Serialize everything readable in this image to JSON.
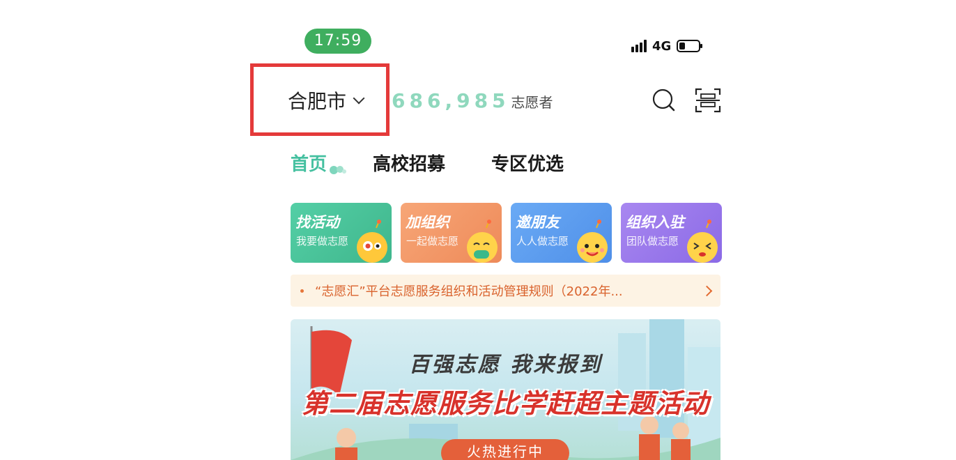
{
  "status_bar": {
    "time": "17:59",
    "network": "4G",
    "battery_level": 0.3
  },
  "header": {
    "city": "合肥市",
    "volunteer_count": "686,985",
    "volunteer_label": "志愿者"
  },
  "tabs": [
    {
      "label": "首页",
      "active": true
    },
    {
      "label": "高校招募",
      "active": false
    },
    {
      "label": "专区优选",
      "active": false
    }
  ],
  "cards": [
    {
      "title": "找活动",
      "subtitle": "我要做志愿",
      "color": "#4dc79d"
    },
    {
      "title": "加组织",
      "subtitle": "一起做志愿",
      "color": "#f39a6b"
    },
    {
      "title": "邀朋友",
      "subtitle": "人人做志愿",
      "color": "#5b9ff0"
    },
    {
      "title": "组织入驻",
      "subtitle": "团队做志愿",
      "color": "#9a78ec"
    }
  ],
  "notice": {
    "text": "“志愿汇”平台志愿服务组织和活动管理规则（2022年..."
  },
  "banner": {
    "slogan": "百强志愿 我来报到",
    "title": "第二届志愿服务比学赶超主题活动",
    "button": "火热进行中",
    "flag_text": "百强志愿"
  },
  "colors": {
    "accent": "#45c0a0",
    "highlight": "#e43a3a"
  }
}
